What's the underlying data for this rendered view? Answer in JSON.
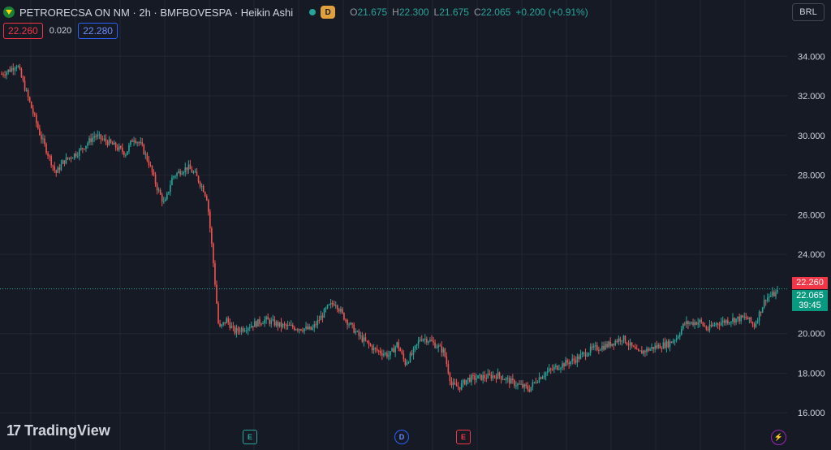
{
  "header": {
    "symbol_line": "PETRORECSA ON NM · 2h · BMFBOVESPA · Heikin Ashi",
    "dividend_badge": "D",
    "ohlc": {
      "o_label": "O",
      "o": "21.675",
      "h_label": "H",
      "h": "22.300",
      "l_label": "L",
      "l": "21.675",
      "c_label": "C",
      "c": "22.065",
      "change": "+0.200 (+0.91%)"
    }
  },
  "trade": {
    "bid": "22.260",
    "spread": "0.020",
    "ask": "22.280"
  },
  "currency": "BRL",
  "price_labels": {
    "bid": "22.260",
    "last": "22.065",
    "countdown": "39:45"
  },
  "events": {
    "earnings_1": "E",
    "dividend": "D",
    "earnings_2": "E",
    "bolt": "⚡"
  },
  "brand": {
    "mark": "17",
    "name": "TradingView"
  },
  "colors": {
    "up": "#26a69a",
    "down": "#ef5350",
    "background": "#161a25",
    "grid": "#232632"
  },
  "chart_data": {
    "type": "line",
    "style": "heikin-ashi candles",
    "yaxis_ticks": [
      "34.000",
      "32.000",
      "30.000",
      "28.000",
      "26.000",
      "24.000",
      "20.000",
      "18.000",
      "16.000"
    ],
    "ylim": [
      15.6,
      35.2
    ],
    "current_price": 22.065,
    "bid_line": 22.26,
    "grid": true,
    "points": [
      [
        0,
        33.1
      ],
      [
        0.01,
        33.3
      ],
      [
        0.02,
        33.6
      ],
      [
        0.03,
        32.4
      ],
      [
        0.05,
        30.0
      ],
      [
        0.07,
        28.1
      ],
      [
        0.08,
        28.7
      ],
      [
        0.1,
        29.2
      ],
      [
        0.12,
        30.0
      ],
      [
        0.14,
        29.6
      ],
      [
        0.16,
        29.1
      ],
      [
        0.17,
        29.9
      ],
      [
        0.18,
        29.5
      ],
      [
        0.19,
        28.6
      ],
      [
        0.2,
        27.4
      ],
      [
        0.21,
        26.5
      ],
      [
        0.22,
        27.9
      ],
      [
        0.23,
        28.2
      ],
      [
        0.24,
        28.4
      ],
      [
        0.25,
        28.0
      ],
      [
        0.26,
        27.3
      ],
      [
        0.265,
        26.8
      ],
      [
        0.272,
        24.0
      ],
      [
        0.28,
        20.2
      ],
      [
        0.29,
        20.7
      ],
      [
        0.3,
        20.1
      ],
      [
        0.32,
        20.4
      ],
      [
        0.34,
        20.7
      ],
      [
        0.36,
        20.4
      ],
      [
        0.38,
        20.3
      ],
      [
        0.4,
        20.2
      ],
      [
        0.42,
        21.3
      ],
      [
        0.43,
        21.6
      ],
      [
        0.44,
        20.9
      ],
      [
        0.46,
        19.9
      ],
      [
        0.48,
        19.2
      ],
      [
        0.5,
        18.9
      ],
      [
        0.51,
        19.5
      ],
      [
        0.52,
        18.5
      ],
      [
        0.53,
        19.0
      ],
      [
        0.54,
        19.8
      ],
      [
        0.55,
        19.7
      ],
      [
        0.57,
        19.1
      ],
      [
        0.58,
        17.4
      ],
      [
        0.59,
        17.3
      ],
      [
        0.6,
        17.7
      ],
      [
        0.62,
        17.8
      ],
      [
        0.64,
        17.9
      ],
      [
        0.66,
        17.5
      ],
      [
        0.68,
        17.2
      ],
      [
        0.69,
        17.7
      ],
      [
        0.7,
        18.0
      ],
      [
        0.72,
        18.4
      ],
      [
        0.74,
        18.7
      ],
      [
        0.76,
        19.2
      ],
      [
        0.78,
        19.4
      ],
      [
        0.8,
        19.8
      ],
      [
        0.82,
        19.0
      ],
      [
        0.84,
        19.3
      ],
      [
        0.86,
        19.5
      ],
      [
        0.87,
        19.8
      ],
      [
        0.88,
        20.5
      ],
      [
        0.9,
        20.6
      ],
      [
        0.91,
        20.2
      ],
      [
        0.92,
        20.5
      ],
      [
        0.94,
        20.7
      ],
      [
        0.96,
        20.8
      ],
      [
        0.97,
        20.4
      ],
      [
        0.985,
        21.8
      ],
      [
        1,
        22.065
      ]
    ]
  }
}
